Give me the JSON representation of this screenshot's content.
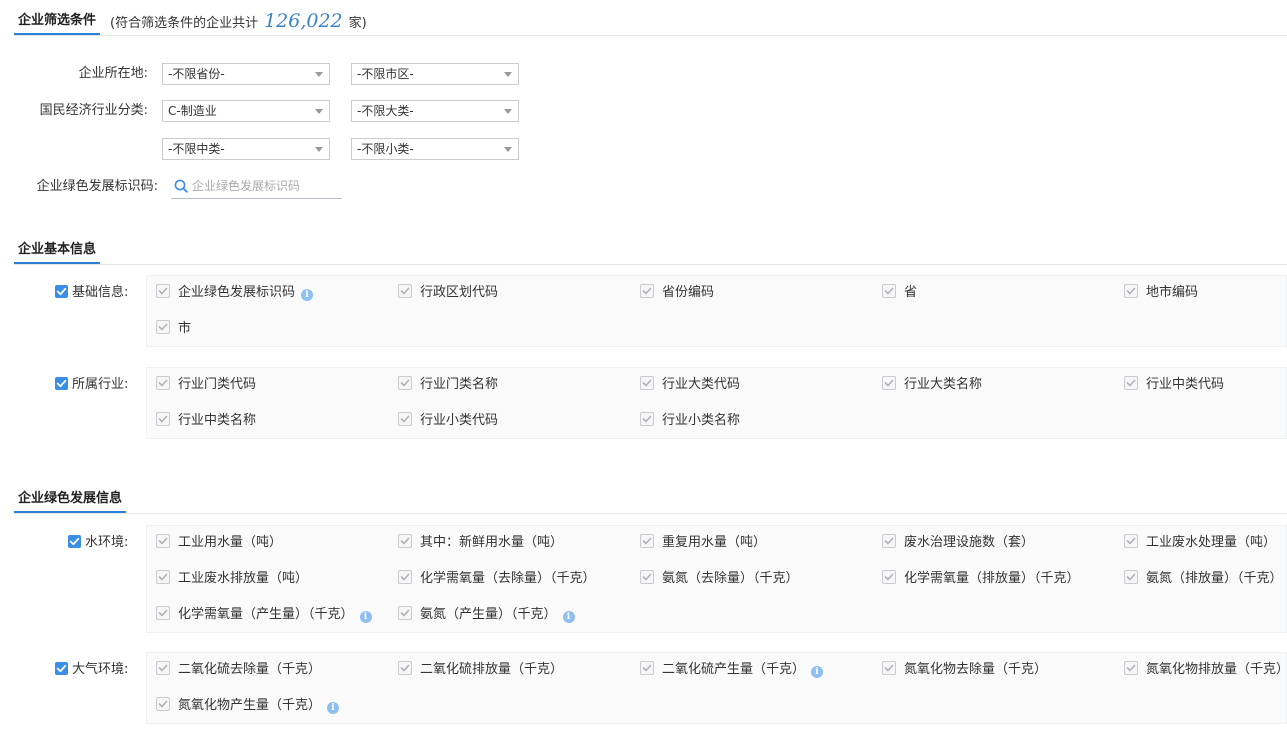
{
  "filter_section": {
    "title": "企业筛选条件",
    "note_prefix": "(符合筛选条件的企业共计",
    "count": "126,022",
    "note_suffix": "家)",
    "location_label": "企业所在地:",
    "province_value": "-不限省份-",
    "city_value": "-不限市区-",
    "industry_label": "国民经济行业分类:",
    "category_value": "C-制造业",
    "major_value": "-不限大类-",
    "medium_value": "-不限中类-",
    "minor_value": "-不限小类-",
    "code_label": "企业绿色发展标识码:",
    "code_placeholder": "企业绿色发展标识码"
  },
  "basic_section": {
    "title": "企业基本信息",
    "groups": [
      {
        "label": "基础信息:",
        "items": [
          {
            "label": "企业绿色发展标识码",
            "info": true
          },
          {
            "label": "行政区划代码"
          },
          {
            "label": "省份编码"
          },
          {
            "label": "省"
          },
          {
            "label": "地市编码"
          },
          {
            "label": "市"
          }
        ]
      },
      {
        "label": "所属行业:",
        "items": [
          {
            "label": "行业门类代码"
          },
          {
            "label": "行业门类名称"
          },
          {
            "label": "行业大类代码"
          },
          {
            "label": "行业大类名称"
          },
          {
            "label": "行业中类代码"
          },
          {
            "label": "行业中类名称"
          },
          {
            "label": "行业小类代码"
          },
          {
            "label": "行业小类名称"
          }
        ]
      }
    ]
  },
  "green_section": {
    "title": "企业绿色发展信息",
    "groups": [
      {
        "label": "水环境:",
        "items": [
          {
            "label": "工业用水量（吨）"
          },
          {
            "label": "其中：新鲜用水量（吨）"
          },
          {
            "label": "重复用水量（吨）"
          },
          {
            "label": "废水治理设施数（套）"
          },
          {
            "label": "工业废水处理量（吨）"
          },
          {
            "label": "工业废水排放量（吨）"
          },
          {
            "label": "化学需氧量（去除量）（千克）"
          },
          {
            "label": "氨氮（去除量）（千克）"
          },
          {
            "label": "化学需氧量（排放量）（千克）"
          },
          {
            "label": "氨氮（排放量）（千克）"
          },
          {
            "label": "化学需氧量（产生量）（千克）",
            "info": true
          },
          {
            "label": "氨氮（产生量）（千克）",
            "info": true
          }
        ]
      },
      {
        "label": "大气环境:",
        "items": [
          {
            "label": "二氧化硫去除量（千克）"
          },
          {
            "label": "二氧化硫排放量（千克）"
          },
          {
            "label": "二氧化硫产生量（千克）",
            "info": true
          },
          {
            "label": "氮氧化物去除量（千克）"
          },
          {
            "label": "氮氧化物排放量（千克）"
          },
          {
            "label": "氮氧化物产生量（千克）",
            "info": true
          }
        ]
      }
    ]
  },
  "colors": {
    "accent": "#3a8ee6",
    "count_color": "#3a83c8",
    "info_icon": "#8fbff0"
  }
}
